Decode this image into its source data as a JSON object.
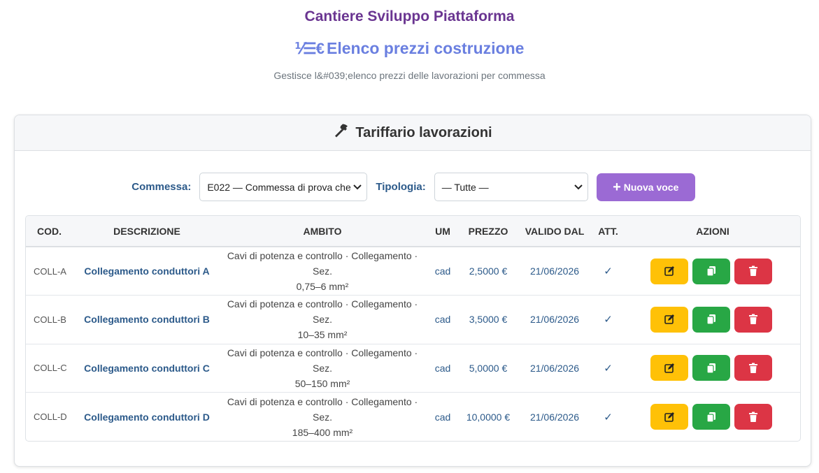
{
  "header": {
    "app_title": "Cantiere Sviluppo Piattaforma",
    "page_title": "Elenco prezzi costruzione",
    "page_title_icon": "list-ordered-euro-icon",
    "subtitle": "Gestisce l&#039;elenco prezzi delle lavorazioni per commessa"
  },
  "card": {
    "title": "Tariffario lavorazioni",
    "title_icon": "hammer-icon"
  },
  "filters": {
    "commessa_label": "Commessa:",
    "commessa_value": "E022 — Commessa di prova che",
    "tipologia_label": "Tipologia:",
    "tipologia_value": "— Tutte —",
    "new_button_label": "Nuova voce"
  },
  "table": {
    "headers": {
      "cod": "COD.",
      "descrizione": "DESCRIZIONE",
      "ambito": "AMBITO",
      "um": "UM",
      "prezzo": "PREZZO",
      "valido_dal": "VALIDO DAL",
      "att": "ATT.",
      "azioni": "AZIONI"
    },
    "rows": [
      {
        "cod": "COLL-A",
        "descrizione": "Collegamento conduttori A",
        "ambito_line1": "Cavi di potenza e controllo · Collegamento · Sez.",
        "ambito_line2": "0,75–6 mm²",
        "um": "cad",
        "prezzo": "2,5000 €",
        "valido_dal": "21/06/2026",
        "att": "✓"
      },
      {
        "cod": "COLL-B",
        "descrizione": "Collegamento conduttori B",
        "ambito_line1": "Cavi di potenza e controllo · Collegamento · Sez.",
        "ambito_line2": "10–35 mm²",
        "um": "cad",
        "prezzo": "3,5000 €",
        "valido_dal": "21/06/2026",
        "att": "✓"
      },
      {
        "cod": "COLL-C",
        "descrizione": "Collegamento conduttori C",
        "ambito_line1": "Cavi di potenza e controllo · Collegamento · Sez.",
        "ambito_line2": "50–150 mm²",
        "um": "cad",
        "prezzo": "5,0000 €",
        "valido_dal": "21/06/2026",
        "att": "✓"
      },
      {
        "cod": "COLL-D",
        "descrizione": "Collegamento conduttori D",
        "ambito_line1": "Cavi di potenza e controllo · Collegamento · Sez.",
        "ambito_line2": "185–400 mm²",
        "um": "cad",
        "prezzo": "10,0000 €",
        "valido_dal": "21/06/2026",
        "att": "✓"
      }
    ]
  },
  "colors": {
    "app_title": "#6a3591",
    "page_title": "#6a7fe0",
    "link_blue": "#2c5a8a",
    "new_button": "#9b6ad4",
    "edit_button": "#ffc107",
    "copy_button": "#28a745",
    "delete_button": "#dc3545"
  }
}
